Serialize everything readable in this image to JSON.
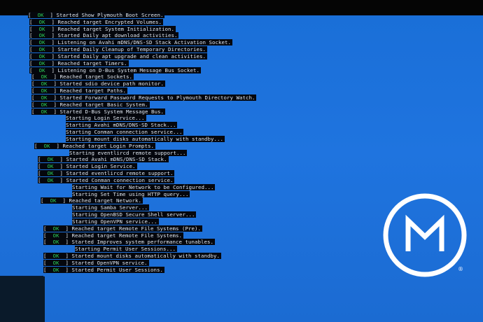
{
  "boot_log": [
    {
      "status": "OK",
      "indent": 0,
      "text": "Started Show Plymouth Boot Screen."
    },
    {
      "status": "OK",
      "indent": 1,
      "text": "Reached target Encrypted Volumes."
    },
    {
      "status": "OK",
      "indent": 1,
      "text": "Reached target System Initialization."
    },
    {
      "status": "OK",
      "indent": 1,
      "text": "Started Daily apt download activities."
    },
    {
      "status": "OK",
      "indent": 1,
      "text": "Listening on Avahi mDNS/DNS-SD Stack Activation Socket."
    },
    {
      "status": "OK",
      "indent": 1,
      "text": "Started Daily Cleanup of Temporary Directories."
    },
    {
      "status": "OK",
      "indent": 1,
      "text": "Started Daily apt upgrade and clean activities."
    },
    {
      "status": "OK",
      "indent": 1,
      "text": "Reached target Timers."
    },
    {
      "status": "OK",
      "indent": 1,
      "text": "Listening on D-Bus System Message Bus Socket."
    },
    {
      "status": "OK",
      "indent": 2,
      "text": "Reached target Sockets."
    },
    {
      "status": "OK",
      "indent": 2,
      "text": "Started sdio device path monitor."
    },
    {
      "status": "OK",
      "indent": 2,
      "text": "Reached target Paths."
    },
    {
      "status": "OK",
      "indent": 2,
      "text": "Started Forward Password Requests to Plymouth Directory Watch."
    },
    {
      "status": "OK",
      "indent": 2,
      "text": "Reached target Basic System."
    },
    {
      "status": "OK",
      "indent": 2,
      "text": "Started D-Bus System Message Bus."
    },
    {
      "status": "",
      "indent": 3,
      "text": "Starting Login Service..."
    },
    {
      "status": "",
      "indent": 3,
      "text": "Starting Avahi mDNS/DNS-SD Stack..."
    },
    {
      "status": "",
      "indent": 3,
      "text": "Starting Conman connection service..."
    },
    {
      "status": "",
      "indent": 3,
      "text": "Starting mount disks automatically with standby..."
    },
    {
      "status": "OK",
      "indent": 3,
      "text": "Reached target Login Prompts."
    },
    {
      "status": "",
      "indent": 4,
      "text": "Starting eventlircd remote support..."
    },
    {
      "status": "OK",
      "indent": 4,
      "text": "Started Avahi mDNS/DNS-SD Stack."
    },
    {
      "status": "OK",
      "indent": 4,
      "text": "Started Login Service."
    },
    {
      "status": "OK",
      "indent": 4,
      "text": "Started eventlircd remote support."
    },
    {
      "status": "OK",
      "indent": 4,
      "text": "Started Conman connection service."
    },
    {
      "status": "",
      "indent": 5,
      "text": "Starting Wait for Network to be Configured..."
    },
    {
      "status": "",
      "indent": 5,
      "text": "Starting Set Time using HTTP query..."
    },
    {
      "status": "OK",
      "indent": 5,
      "text": "Reached target Network."
    },
    {
      "status": "",
      "indent": 5,
      "text": "Starting Samba Server..."
    },
    {
      "status": "",
      "indent": 5,
      "text": "Starting OpenBSD Secure Shell server..."
    },
    {
      "status": "",
      "indent": 5,
      "text": "Starting OpenVPN service..."
    },
    {
      "status": "OK",
      "indent": 6,
      "text": "Reached target Remote File Systems (Pre)."
    },
    {
      "status": "OK",
      "indent": 6,
      "text": "Reached target Remote File Systems."
    },
    {
      "status": "OK",
      "indent": 6,
      "text": "Started Improves system performance tunables."
    },
    {
      "status": "",
      "indent": 6,
      "text": "Starting Permit User Sessions..."
    },
    {
      "status": "OK",
      "indent": 6,
      "text": "Started mount disks automatically with standby."
    },
    {
      "status": "OK",
      "indent": 6,
      "text": "Started OpenVPN service."
    },
    {
      "status": "OK",
      "indent": 6,
      "text": "Started Permit User Sessions."
    }
  ],
  "logo": {
    "icon": "osmc-logo-icon",
    "registered_mark": "®",
    "color": "#ffffff"
  },
  "colors": {
    "desktop_blue": "#1f74df",
    "ok_green": "#2fd25a",
    "text": "#dfe6ef"
  }
}
